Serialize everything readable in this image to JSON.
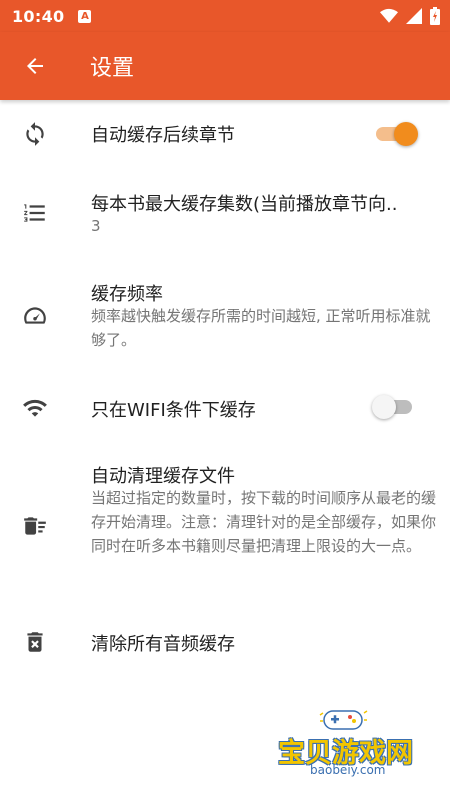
{
  "status_bar": {
    "time": "10:40",
    "notification_icon": "A"
  },
  "app_bar": {
    "title": "设置",
    "back_icon": "arrow-left-icon"
  },
  "settings": [
    {
      "title": "自动缓存后续章节",
      "icon": "sync-icon",
      "switch": true
    },
    {
      "title": "每本书最大缓存集数(当前播放章节向..",
      "subtitle": "3",
      "icon": "numbered-list-icon"
    },
    {
      "title": "缓存频率",
      "subtitle": "频率越快触发缓存所需的时间越短, 正常听用标准就够了。",
      "icon": "speedometer-icon"
    },
    {
      "title": "只在WIFI条件下缓存",
      "icon": "wifi-icon",
      "switch": false
    },
    {
      "title": "自动清理缓存文件",
      "subtitle": "当超过指定的数量时，按下载的时间顺序从最老的缓存开始清理。注意：清理针对的是全部缓存，如果你同时在听多本书籍则尽量把清理上限设的大一点。",
      "icon": "delete-sweep-icon"
    },
    {
      "title": "清除所有音频缓存",
      "icon": "delete-forever-icon"
    }
  ],
  "watermark": {
    "text": "宝贝游戏网",
    "url": "baobeiy.com"
  },
  "colors": {
    "primary": "#e8572a",
    "switch_on": "#f18c1d"
  }
}
